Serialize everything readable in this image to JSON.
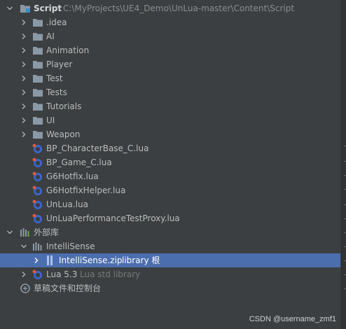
{
  "tree": {
    "root": {
      "name": "Script",
      "path": "C:\\MyProjects\\UE4_Demo\\UnLua-master\\Content\\Script"
    },
    "folders": [
      "idea",
      "AI",
      "Animation",
      "Player",
      "Test",
      "Tests",
      "Tutorials",
      "UI",
      "Weapon"
    ],
    "files": [
      "BP_CharacterBase_C.lua",
      "BP_Game_C.lua",
      "G6Hotfix.lua",
      "G6HotfixHelper.lua",
      "UnLua.lua",
      "UnLuaPerformanceTestProxy.lua"
    ],
    "external": {
      "label": "外部库",
      "intellisense": {
        "label": "IntelliSense",
        "zip": {
          "name": "IntelliSense.zip",
          "hint": "library 根"
        }
      },
      "lua": {
        "name": "Lua 5.3",
        "hint": "Lua std library"
      }
    },
    "scratches": "草稿文件和控制台"
  },
  "watermark": "CSDN @username_zmf1",
  "colors": {
    "background": "#3c3f41",
    "selection": "#4b6eaf",
    "folder": "#8b98a6",
    "lua_icon": "#3a66cf",
    "lua_badge": "#e05a3f"
  }
}
